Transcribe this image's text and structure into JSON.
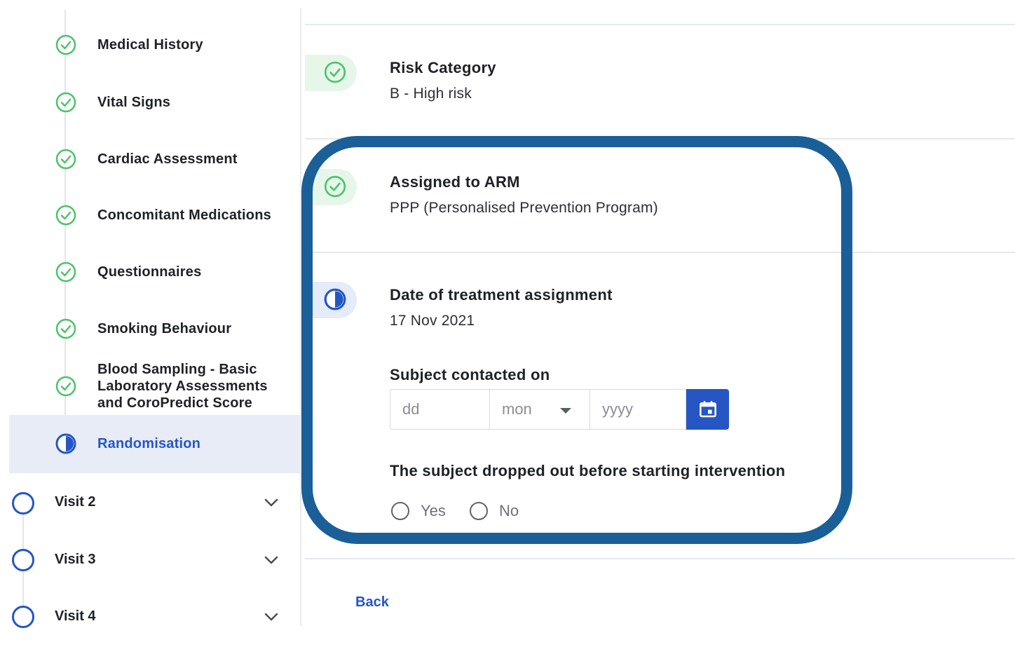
{
  "sidebar": {
    "steps": [
      {
        "label": "Medical History",
        "status": "complete"
      },
      {
        "label": "Vital Signs",
        "status": "complete"
      },
      {
        "label": "Cardiac Assessment",
        "status": "complete"
      },
      {
        "label": "Concomitant Medications",
        "status": "complete"
      },
      {
        "label": "Questionnaires",
        "status": "complete"
      },
      {
        "label": "Smoking Behaviour",
        "status": "complete"
      },
      {
        "label": "Blood Sampling - Basic Laboratory Assessments and CoroPredict Score",
        "line1": "Blood Sampling - Basic",
        "line2": "Laboratory Assessments",
        "line3": "and CoroPredict Score",
        "status": "complete"
      },
      {
        "label": "Randomisation",
        "status": "in-progress"
      }
    ],
    "visits": [
      {
        "label": "Visit 2"
      },
      {
        "label": "Visit 3"
      },
      {
        "label": "Visit 4"
      }
    ]
  },
  "main": {
    "risk": {
      "title": "Risk Category",
      "value": "B - High risk"
    },
    "arm": {
      "title": "Assigned to ARM",
      "value": "PPP (Personalised Prevention Program)"
    },
    "treatment_date": {
      "title": "Date of treatment assignment",
      "value": "17 Nov 2021"
    },
    "contacted": {
      "title": "Subject contacted on",
      "day_placeholder": "dd",
      "month_value": "mon",
      "year_placeholder": "yyyy"
    },
    "dropout": {
      "title": "The subject dropped out before starting intervention",
      "options": [
        "Yes",
        "No"
      ]
    },
    "back_label": "Back"
  },
  "colors": {
    "accent": "#2556c4",
    "success": "#4cc46a",
    "highlight_border": "#1b5f98",
    "active_bg": "#e7ecf7"
  }
}
